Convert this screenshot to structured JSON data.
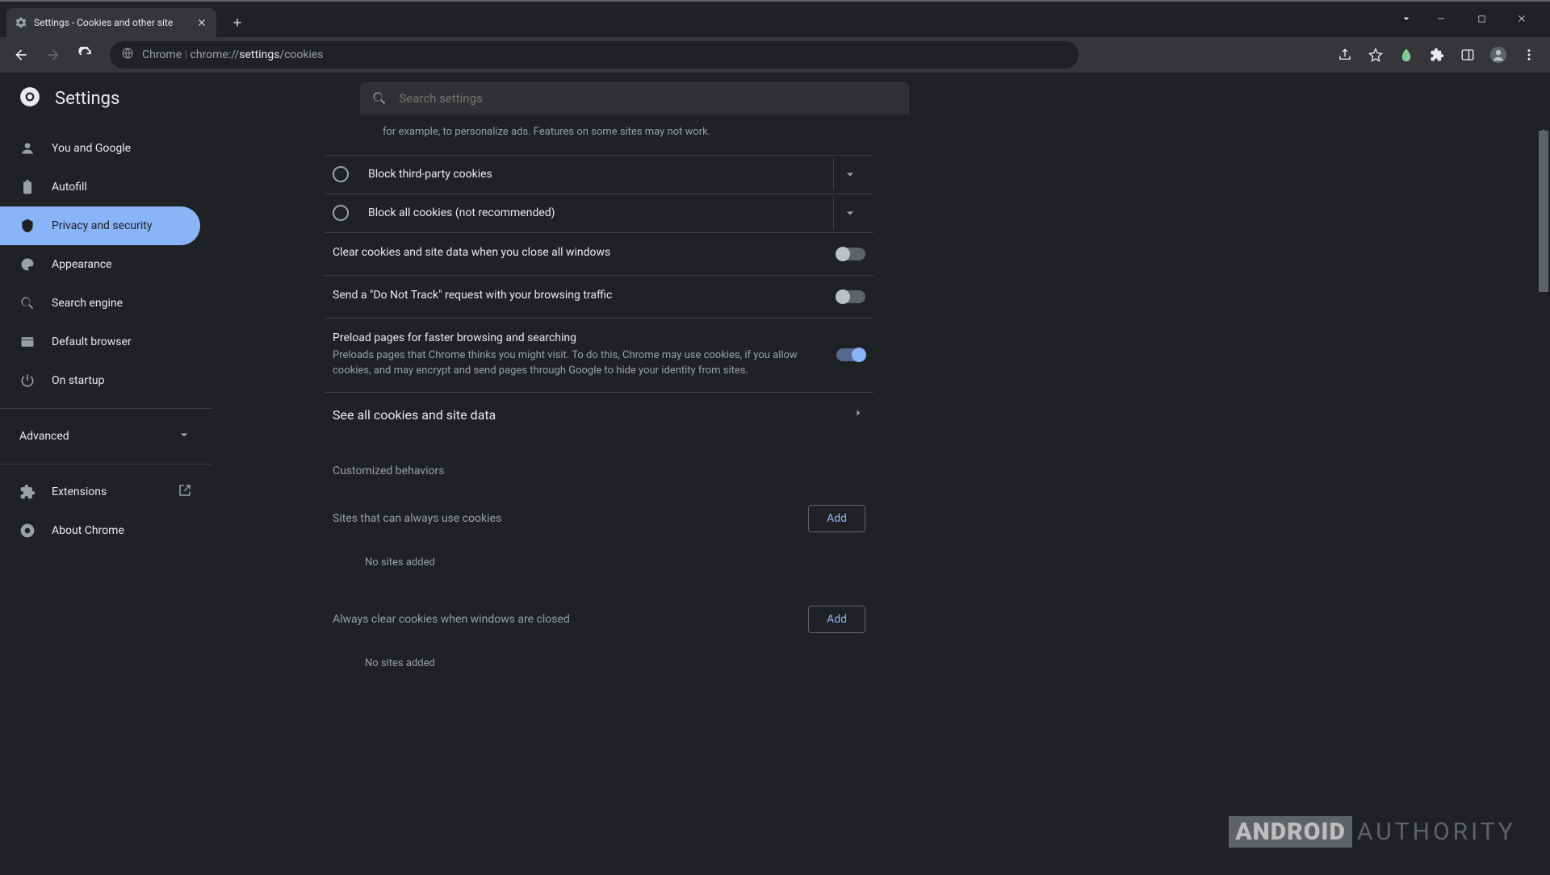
{
  "tab": {
    "title": "Settings - Cookies and other site"
  },
  "omnibox": {
    "scheme_label": "Chrome",
    "url_prefix": "chrome://",
    "url_bold": "settings",
    "url_suffix": "/cookies"
  },
  "header": {
    "title": "Settings",
    "search_placeholder": "Search settings"
  },
  "sidebar": {
    "items": [
      {
        "label": "You and Google"
      },
      {
        "label": "Autofill"
      },
      {
        "label": "Privacy and security"
      },
      {
        "label": "Appearance"
      },
      {
        "label": "Search engine"
      },
      {
        "label": "Default browser"
      },
      {
        "label": "On startup"
      }
    ],
    "advanced": "Advanced",
    "extensions": "Extensions",
    "about": "About Chrome"
  },
  "content": {
    "trailing_desc": "for example, to personalize ads. Features on some sites may not work.",
    "opt_third_party": "Block third-party cookies",
    "opt_all": "Block all cookies (not recommended)",
    "clear_on_close": "Clear cookies and site data when you close all windows",
    "dnt": "Send a \"Do Not Track\" request with your browsing traffic",
    "preload_title": "Preload pages for faster browsing and searching",
    "preload_desc": "Preloads pages that Chrome thinks you might visit. To do this, Chrome may use cookies, if you allow cookies, and may encrypt and send pages through Google to hide your identity from sites.",
    "see_all": "See all cookies and site data",
    "custom_behaviors": "Customized behaviors",
    "always_allow": "Sites that can always use cookies",
    "always_clear": "Always clear cookies when windows are closed",
    "add": "Add",
    "no_sites": "No sites added"
  },
  "watermark": {
    "box": "ANDROID",
    "text": "AUTHORITY"
  }
}
